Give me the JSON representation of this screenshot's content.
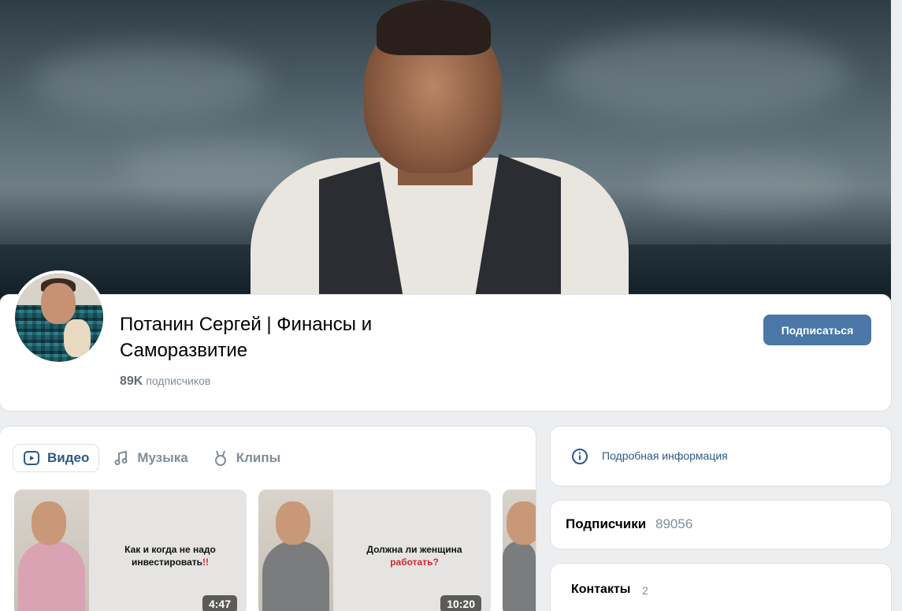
{
  "group": {
    "name": "Потанин Сергей | Финансы и Саморазвитие",
    "subscribers_short": "89K",
    "subscribers_label": "подписчиков",
    "subscribe_label": "Подписаться"
  },
  "tabs": [
    {
      "label": "Видео",
      "icon": "video-icon",
      "active": true
    },
    {
      "label": "Музыка",
      "icon": "music-note-icon",
      "active": false
    },
    {
      "label": "Клипы",
      "icon": "clips-icon",
      "active": false
    }
  ],
  "videos": [
    {
      "title_main": "Как и когда не надо инвестировать",
      "title_accent": "!!",
      "duration": "4:47"
    },
    {
      "title_main": "Должна ли женщина ",
      "title_accent": "работать?",
      "duration": "10:20"
    }
  ],
  "sidebar": {
    "info_label": "Подробная информация",
    "followers_label": "Подписчики",
    "followers_count": "89056",
    "contacts_label": "Контакты",
    "contacts_count": "2"
  },
  "colors": {
    "accent": "#4a76a8",
    "link": "#2c5987",
    "muted": "#818c99",
    "background": "#edeef0"
  }
}
